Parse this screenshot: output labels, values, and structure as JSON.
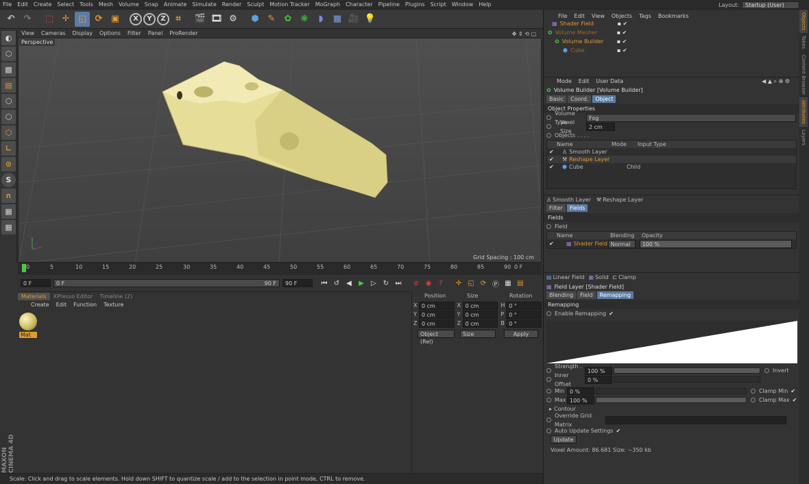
{
  "menubar": {
    "items": [
      "File",
      "Edit",
      "Create",
      "Select",
      "Tools",
      "Mesh",
      "Volume",
      "Snap",
      "Animate",
      "Simulate",
      "Render",
      "Sculpt",
      "Motion Tracker",
      "MoGraph",
      "Character",
      "Pipeline",
      "Plugins",
      "Script",
      "Window",
      "Help"
    ],
    "layout_label": "Layout:",
    "layout_value": "Startup (User)"
  },
  "viewport": {
    "menu": [
      "View",
      "Cameras",
      "Display",
      "Options",
      "Filter",
      "Panel",
      "ProRender"
    ],
    "label": "Perspective",
    "grid_spacing": "Grid Spacing : 100 cm"
  },
  "timeline": {
    "ticks": [
      "0",
      "5",
      "10",
      "15",
      "20",
      "25",
      "30",
      "35",
      "40",
      "45",
      "50",
      "55",
      "60",
      "65",
      "70",
      "75",
      "80",
      "85",
      "90"
    ],
    "end_frame": "0 F",
    "start_field": "0 F",
    "current_field": "0 F",
    "range_end": "90 F",
    "max_field": "90 F"
  },
  "materials": {
    "tabs": [
      "Materials",
      "XPresso Editor",
      "Timeline (2)"
    ],
    "menu": [
      "Create",
      "Edit",
      "Function",
      "Texture"
    ],
    "mat_name": "Mat"
  },
  "coords": {
    "headers": [
      "Position",
      "Size",
      "Rotation"
    ],
    "rows": [
      {
        "a": "X",
        "p": "0 cm",
        "b": "X",
        "s": "0 cm",
        "c": "H",
        "r": "0 °"
      },
      {
        "a": "Y",
        "p": "0 cm",
        "b": "Y",
        "s": "0 cm",
        "c": "P",
        "r": "0 °"
      },
      {
        "a": "Z",
        "p": "0 cm",
        "b": "Z",
        "s": "0 cm",
        "c": "B",
        "r": "0 °"
      }
    ],
    "mode": "Object (Rel)",
    "size_mode": "Size",
    "apply": "Apply"
  },
  "objects": {
    "menu": [
      "File",
      "Edit",
      "View",
      "Objects",
      "Tags",
      "Bookmarks"
    ],
    "items": [
      {
        "name": "Shader Field",
        "color": "#e09a30",
        "indent": 0
      },
      {
        "name": "Volume Mesher",
        "color": "#9a6a2a",
        "indent": 0
      },
      {
        "name": "Volume Builder",
        "color": "#e09a30",
        "indent": 1
      },
      {
        "name": "Cube",
        "color": "#9a6a2a",
        "indent": 2
      }
    ]
  },
  "attributes": {
    "menu": [
      "Mode",
      "Edit",
      "User Data"
    ],
    "title": "Volume Builder [Volume Builder]",
    "tabs": [
      "Basic",
      "Coord.",
      "Object"
    ],
    "section": "Object Properties",
    "volume_type_label": "Volume Type",
    "volume_type": "Fog",
    "voxel_size_label": "Voxel Size",
    "voxel_size": "2 cm",
    "objects_label": "Objects . . . .",
    "list_headers": [
      "Name",
      "Mode",
      "Input Type"
    ],
    "list": [
      {
        "name": "Smooth Layer",
        "mode": "",
        "type": "",
        "color": "#ccc"
      },
      {
        "name": "Reshape Layer",
        "mode": "",
        "type": "",
        "color": "#e09a30"
      },
      {
        "name": "Cube",
        "mode": "",
        "type": "Child",
        "color": "#ccc"
      }
    ]
  },
  "layers": {
    "buttons": [
      "Smooth Layer",
      "Reshape Layer"
    ],
    "tabs": [
      "Filter",
      "Fields"
    ],
    "section": "Fields",
    "field_label": "Field",
    "headers": [
      "Name",
      "Blending",
      "Opacity"
    ],
    "row": {
      "name": "Shader Field",
      "blending": "Normal",
      "opacity": "100 %"
    }
  },
  "fieldlayer": {
    "buttons": [
      "Linear Field",
      "Solid",
      "Clamp"
    ],
    "title": "Field Layer [Shader Field]",
    "tabs": [
      "Blending",
      "Field",
      "Remapping"
    ],
    "section": "Remapping",
    "enable": "Enable Remapping",
    "strength_label": "Strength . . .",
    "strength": "100 %",
    "invert": "Invert",
    "inner_label": "Inner Offset",
    "inner": "0 %",
    "min_label": "Min",
    "min": "0 %",
    "max_label": "Max",
    "max": "100 %",
    "clamp_min": "Clamp Min",
    "clamp_max": "Clamp Max",
    "contour": "Contour",
    "override": "Override Grid Matrix",
    "auto_update": "Auto Update Settings",
    "update": "Update",
    "voxel_info": "Voxel Amount: 86.681   Size: ~350 kb"
  },
  "side_tabs": [
    "Objects",
    "Takes",
    "Content Browser",
    "Attributes",
    "Layers"
  ],
  "status": "Scale: Click and drag to scale elements. Hold down SHIFT to quantize scale / add to the selection in point mode, CTRL to remove.",
  "logo": "MAXON CINEMA 4D"
}
